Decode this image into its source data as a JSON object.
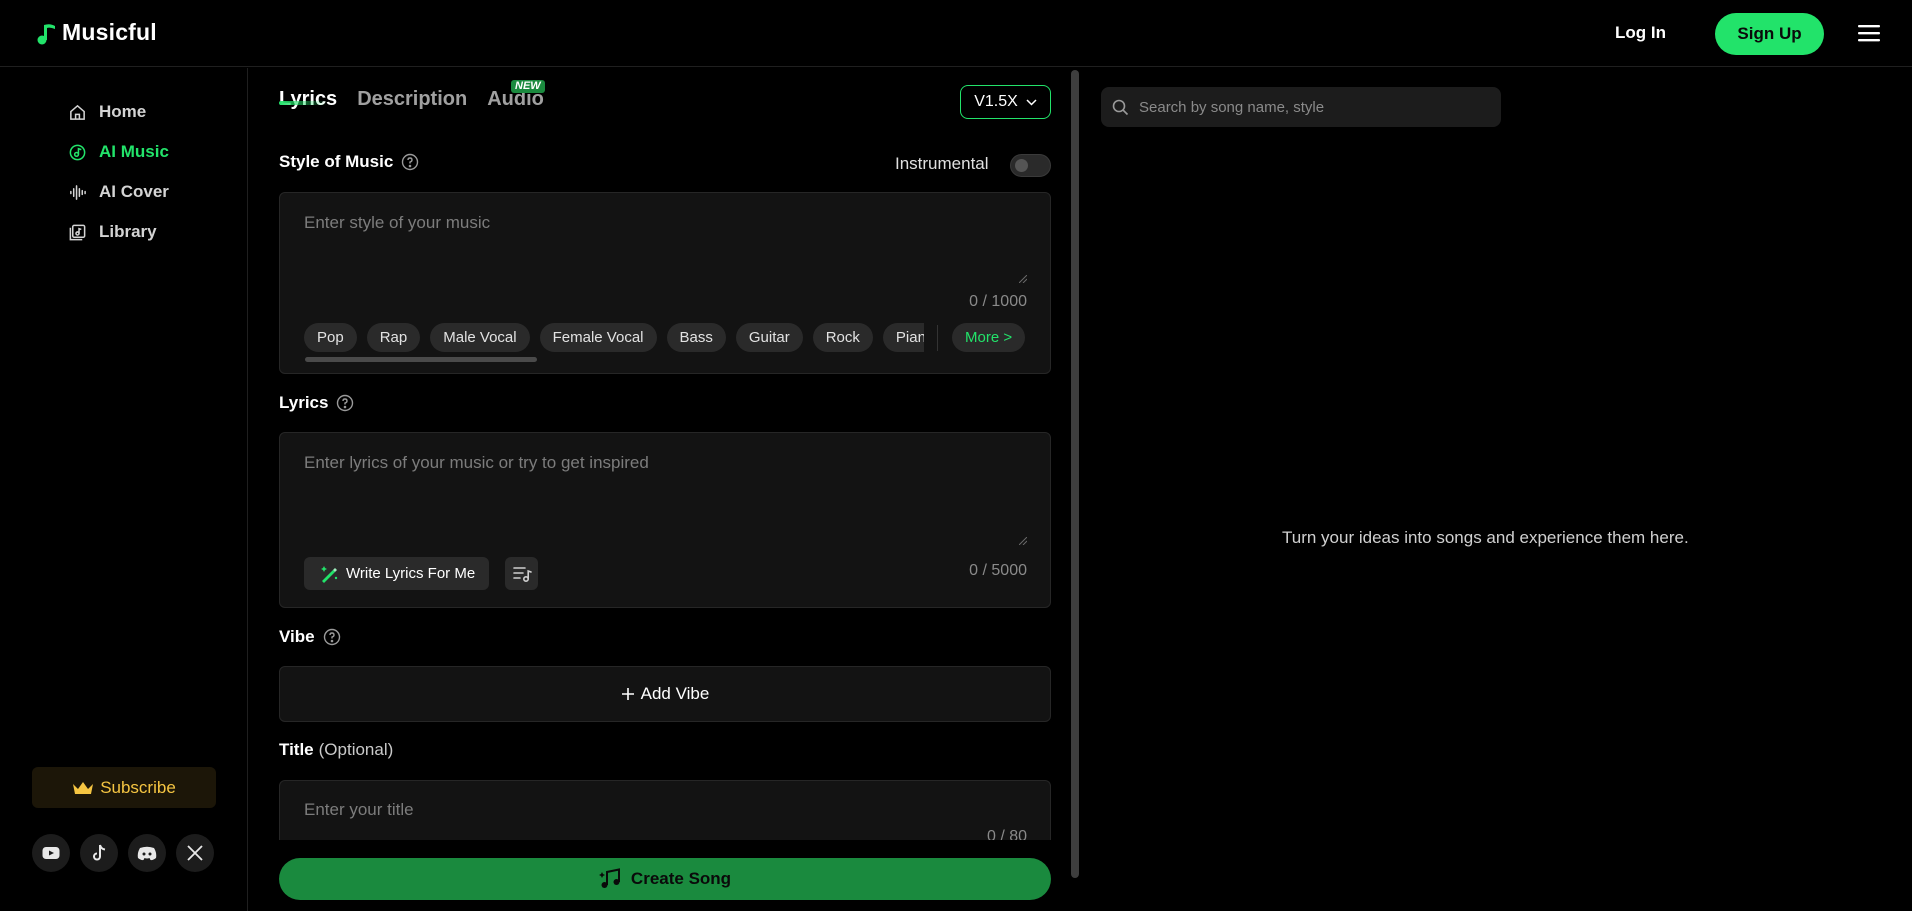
{
  "app": {
    "name": "Musicful"
  },
  "header": {
    "login_label": "Log In",
    "signup_label": "Sign Up"
  },
  "sidebar": {
    "items": [
      {
        "label": "Home",
        "icon": "home-icon"
      },
      {
        "label": "AI Music",
        "icon": "ai-music-icon",
        "active": true
      },
      {
        "label": "AI Cover",
        "icon": "waveform-icon"
      },
      {
        "label": "Library",
        "icon": "library-icon"
      }
    ],
    "subscribe_label": "Subscribe",
    "socials": [
      "youtube-icon",
      "tiktok-icon",
      "discord-icon",
      "x-icon"
    ]
  },
  "main": {
    "tabs": [
      {
        "label": "Lyrics",
        "active": true
      },
      {
        "label": "Description"
      },
      {
        "label": "Audio",
        "badge": "NEW"
      }
    ],
    "version_label": "V1.5X",
    "style": {
      "label": "Style of Music",
      "instrumental_label": "Instrumental",
      "instrumental_on": false,
      "placeholder": "Enter style of your music",
      "counter": "0 / 1000",
      "tags": [
        "Pop",
        "Rap",
        "Male Vocal",
        "Female Vocal",
        "Bass",
        "Guitar",
        "Rock",
        "Piano"
      ],
      "more_label": "More >"
    },
    "lyrics": {
      "label": "Lyrics",
      "placeholder": "Enter lyrics of your music or try to get inspired",
      "write_label": "Write Lyrics For Me",
      "counter": "0 / 5000"
    },
    "vibe": {
      "label": "Vibe",
      "add_label": "Add Vibe"
    },
    "title": {
      "label": "Title",
      "optional": "(Optional)",
      "placeholder": "Enter your title",
      "counter": "0 / 80"
    },
    "create_label": "Create Song"
  },
  "right": {
    "search_placeholder": "Search by song name, style",
    "empty_text": "Turn your ideas into songs and experience them here."
  },
  "colors": {
    "accent": "#22e36a",
    "button_dark_green": "#1a8a3e",
    "subscribe_gold": "#f5c542"
  }
}
